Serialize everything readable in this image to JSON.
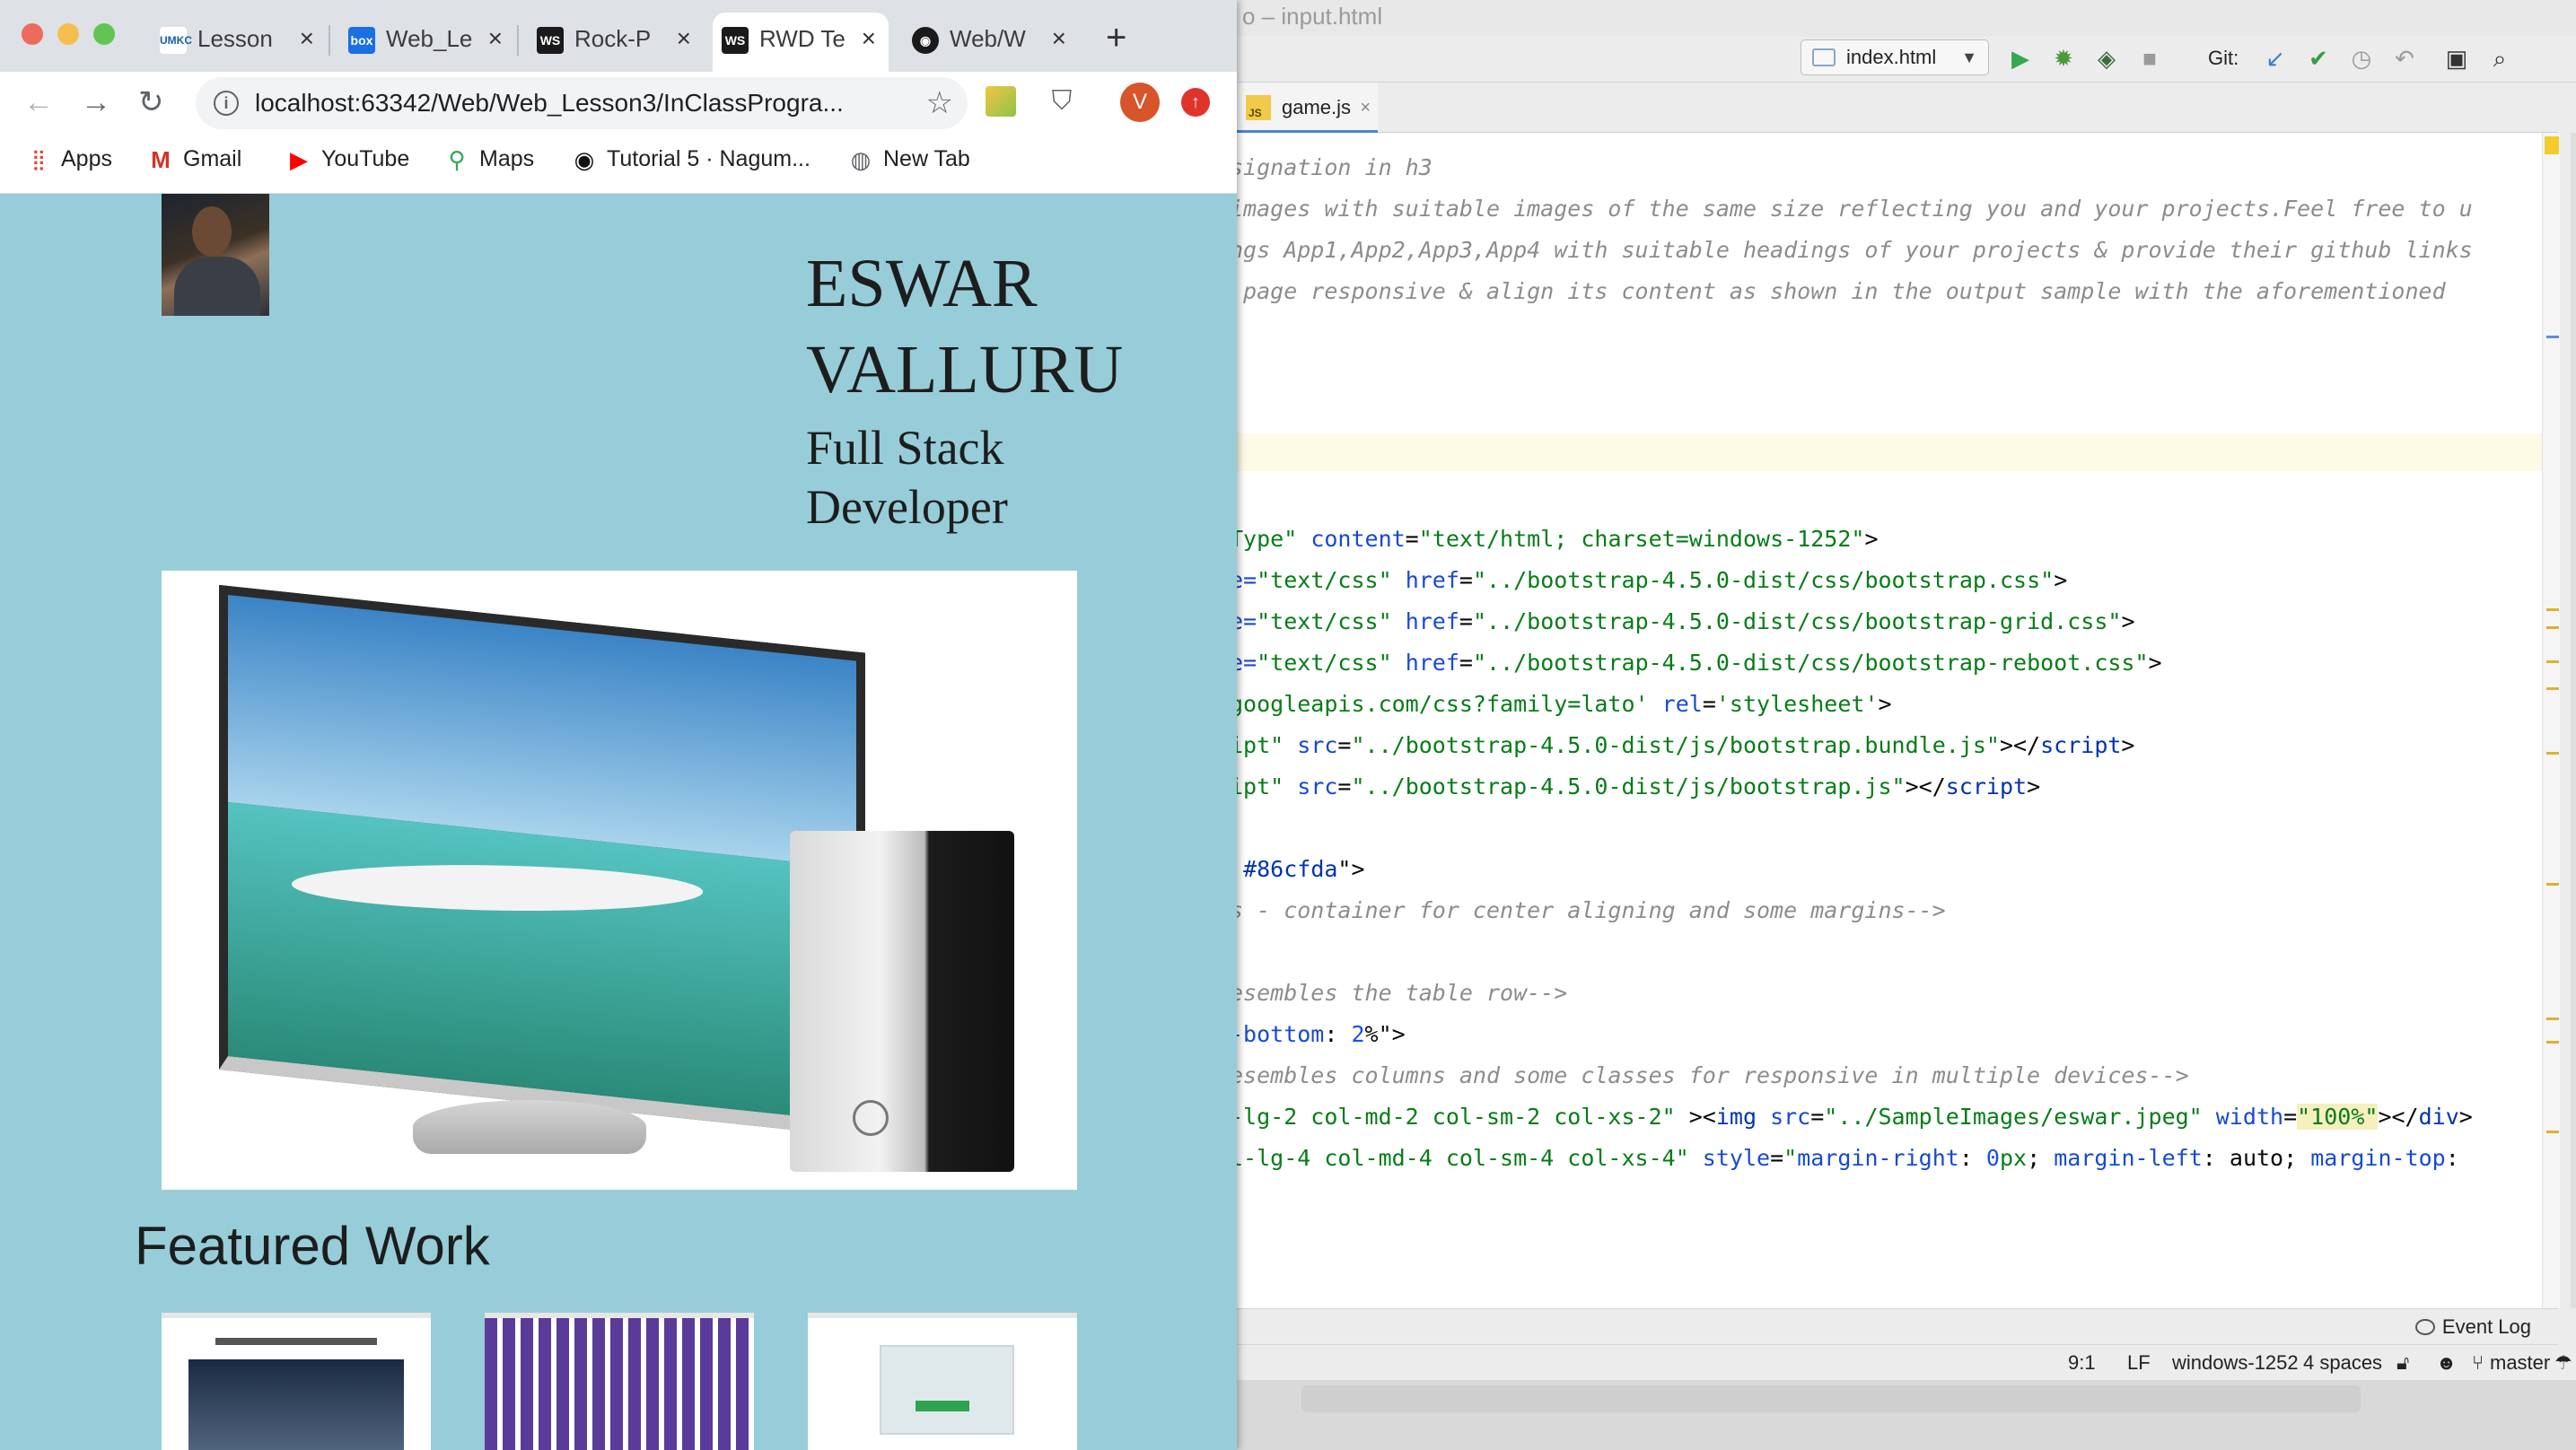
{
  "browser": {
    "tabs": [
      {
        "title": "Lesson",
        "favicon": "umkc"
      },
      {
        "title": "Web_Le",
        "favicon": "box"
      },
      {
        "title": "Rock-P",
        "favicon": "ws"
      },
      {
        "title": "RWD Te",
        "favicon": "ws",
        "active": true
      },
      {
        "title": "Web/W",
        "favicon": "github"
      }
    ],
    "url": "localhost:63342/Web/Web_Lesson3/InClassProgra...",
    "profile_initial": "V",
    "bookmarks": [
      {
        "label": "Apps",
        "icon": "apps-grid-icon"
      },
      {
        "label": "Gmail",
        "icon": "gmail-icon"
      },
      {
        "label": "YouTube",
        "icon": "youtube-icon"
      },
      {
        "label": "Maps",
        "icon": "maps-icon"
      },
      {
        "label": "Tutorial 5 · Nagum...",
        "icon": "github-icon"
      },
      {
        "label": "New Tab",
        "icon": "globe-icon"
      }
    ],
    "page": {
      "name_line1": "ESWAR",
      "name_line2": "VALLURU",
      "role_line1": "Full Stack",
      "role_line2": "Developer",
      "featured_heading": "Featured Work",
      "background": "#97cdd8"
    }
  },
  "ide": {
    "title": "o – input.html",
    "run_config": "index.html",
    "git_label": "Git:",
    "open_tab": "game.js",
    "code_lines": [
      [
        {
          "t": "signation in h3",
          "c": "com"
        }
      ],
      [
        {
          "t": "images with suitable images of the same size reflecting you and your projects.Feel free to u",
          "c": "com"
        }
      ],
      [
        {
          "t": "ngs App1,App2,App3,App4 with suitable headings of your projects & provide their github links",
          "c": "com"
        }
      ],
      [
        {
          "t": " page responsive & align its content as shown in the output sample with the aforementioned",
          "c": "com"
        }
      ],
      [],
      [],
      [],
      [],
      [],
      [
        {
          "t": "Type\" ",
          "c": "str"
        },
        {
          "t": "content",
          "c": "attr"
        },
        {
          "t": "=",
          "c": "plain"
        },
        {
          "t": "\"text/html; charset=windows-1252\"",
          "c": "str"
        },
        {
          "t": ">",
          "c": "plain"
        }
      ],
      [
        {
          "t": "e=",
          "c": "attr"
        },
        {
          "t": "\"text/css\" ",
          "c": "str"
        },
        {
          "t": "href",
          "c": "attr"
        },
        {
          "t": "=",
          "c": "plain"
        },
        {
          "t": "\"../bootstrap-4.5.0-dist/css/bootstrap.css\"",
          "c": "str"
        },
        {
          "t": ">",
          "c": "plain"
        }
      ],
      [
        {
          "t": "e=",
          "c": "attr"
        },
        {
          "t": "\"text/css\" ",
          "c": "str"
        },
        {
          "t": "href",
          "c": "attr"
        },
        {
          "t": "=",
          "c": "plain"
        },
        {
          "t": "\"../bootstrap-4.5.0-dist/css/bootstrap-grid.css\"",
          "c": "str"
        },
        {
          "t": ">",
          "c": "plain"
        }
      ],
      [
        {
          "t": "e=",
          "c": "attr"
        },
        {
          "t": "\"text/css\" ",
          "c": "str"
        },
        {
          "t": "href",
          "c": "attr"
        },
        {
          "t": "=",
          "c": "plain"
        },
        {
          "t": "\"../bootstrap-4.5.0-dist/css/bootstrap-reboot.css\"",
          "c": "str"
        },
        {
          "t": ">",
          "c": "plain"
        }
      ],
      [
        {
          "t": "googleapis.com/css?family=lato",
          "c": "str"
        },
        {
          "t": "' ",
          "c": "str"
        },
        {
          "t": "rel",
          "c": "attr"
        },
        {
          "t": "=",
          "c": "plain"
        },
        {
          "t": "'stylesheet'",
          "c": "str"
        },
        {
          "t": ">",
          "c": "plain"
        }
      ],
      [
        {
          "t": "ipt\" ",
          "c": "str"
        },
        {
          "t": "src",
          "c": "attr"
        },
        {
          "t": "=",
          "c": "plain"
        },
        {
          "t": "\"../bootstrap-4.5.0-dist/js/bootstrap.bundle.js\"",
          "c": "str"
        },
        {
          "t": "></",
          "c": "plain"
        },
        {
          "t": "script",
          "c": "tag"
        },
        {
          "t": ">",
          "c": "plain"
        }
      ],
      [
        {
          "t": "ipt\" ",
          "c": "str"
        },
        {
          "t": "src",
          "c": "attr"
        },
        {
          "t": "=",
          "c": "plain"
        },
        {
          "t": "\"../bootstrap-4.5.0-dist/js/bootstrap.js\"",
          "c": "str"
        },
        {
          "t": "></",
          "c": "plain"
        },
        {
          "t": "script",
          "c": "tag"
        },
        {
          "t": ">",
          "c": "plain"
        }
      ],
      [],
      [
        {
          "t": " ",
          "c": "plain"
        },
        {
          "t": "#86cfda",
          "c": "tag"
        },
        {
          "t": "\">",
          "c": "plain"
        }
      ],
      [
        {
          "t": "s - container for center aligning and some margins-->",
          "c": "com"
        }
      ],
      [],
      [
        {
          "t": "esembles the table row-->",
          "c": "com"
        }
      ],
      [
        {
          "t": "-bottom",
          "c": "attr"
        },
        {
          "t": ": ",
          "c": "plain"
        },
        {
          "t": "2",
          "c": "num"
        },
        {
          "t": "%\">",
          "c": "plain"
        }
      ],
      [
        {
          "t": "esembles columns and some classes for responsive in multiple devices-->",
          "c": "com"
        }
      ],
      [
        {
          "t": "-lg-2 col-md-2 col-sm-2 col-xs-2\" ",
          "c": "str"
        },
        {
          "t": "><",
          "c": "plain"
        },
        {
          "t": "img ",
          "c": "tag"
        },
        {
          "t": "src",
          "c": "attr"
        },
        {
          "t": "=",
          "c": "plain"
        },
        {
          "t": "\"../SampleImages/eswar.jpeg\" ",
          "c": "str"
        },
        {
          "t": "width",
          "c": "attr"
        },
        {
          "t": "=",
          "c": "plain"
        },
        {
          "t": "\"100%\"",
          "c": "str"
        },
        {
          "t": "></",
          "c": "plain"
        },
        {
          "t": "div",
          "c": "tag"
        },
        {
          "t": ">",
          "c": "plain"
        }
      ],
      [
        {
          "t": "l-lg-4 col-md-4 col-sm-4 col-xs-4\" ",
          "c": "str"
        },
        {
          "t": "style",
          "c": "attr"
        },
        {
          "t": "=",
          "c": "plain"
        },
        {
          "t": "\"",
          "c": "str"
        },
        {
          "t": "margin-right",
          "c": "attr"
        },
        {
          "t": ": ",
          "c": "plain"
        },
        {
          "t": "0",
          "c": "num"
        },
        {
          "t": "px",
          "c": "str"
        },
        {
          "t": "; ",
          "c": "plain"
        },
        {
          "t": "margin-left",
          "c": "attr"
        },
        {
          "t": ": ",
          "c": "plain"
        },
        {
          "t": "auto",
          "c": "plain"
        },
        {
          "t": "; ",
          "c": "plain"
        },
        {
          "t": "margin-top",
          "c": "attr"
        },
        {
          "t": ":",
          "c": "plain"
        }
      ]
    ],
    "event_log": "Event Log",
    "status": {
      "position": "9:1",
      "line_sep": "LF",
      "encoding": "windows-1252",
      "indent": "4 spaces",
      "branch": "master"
    }
  }
}
